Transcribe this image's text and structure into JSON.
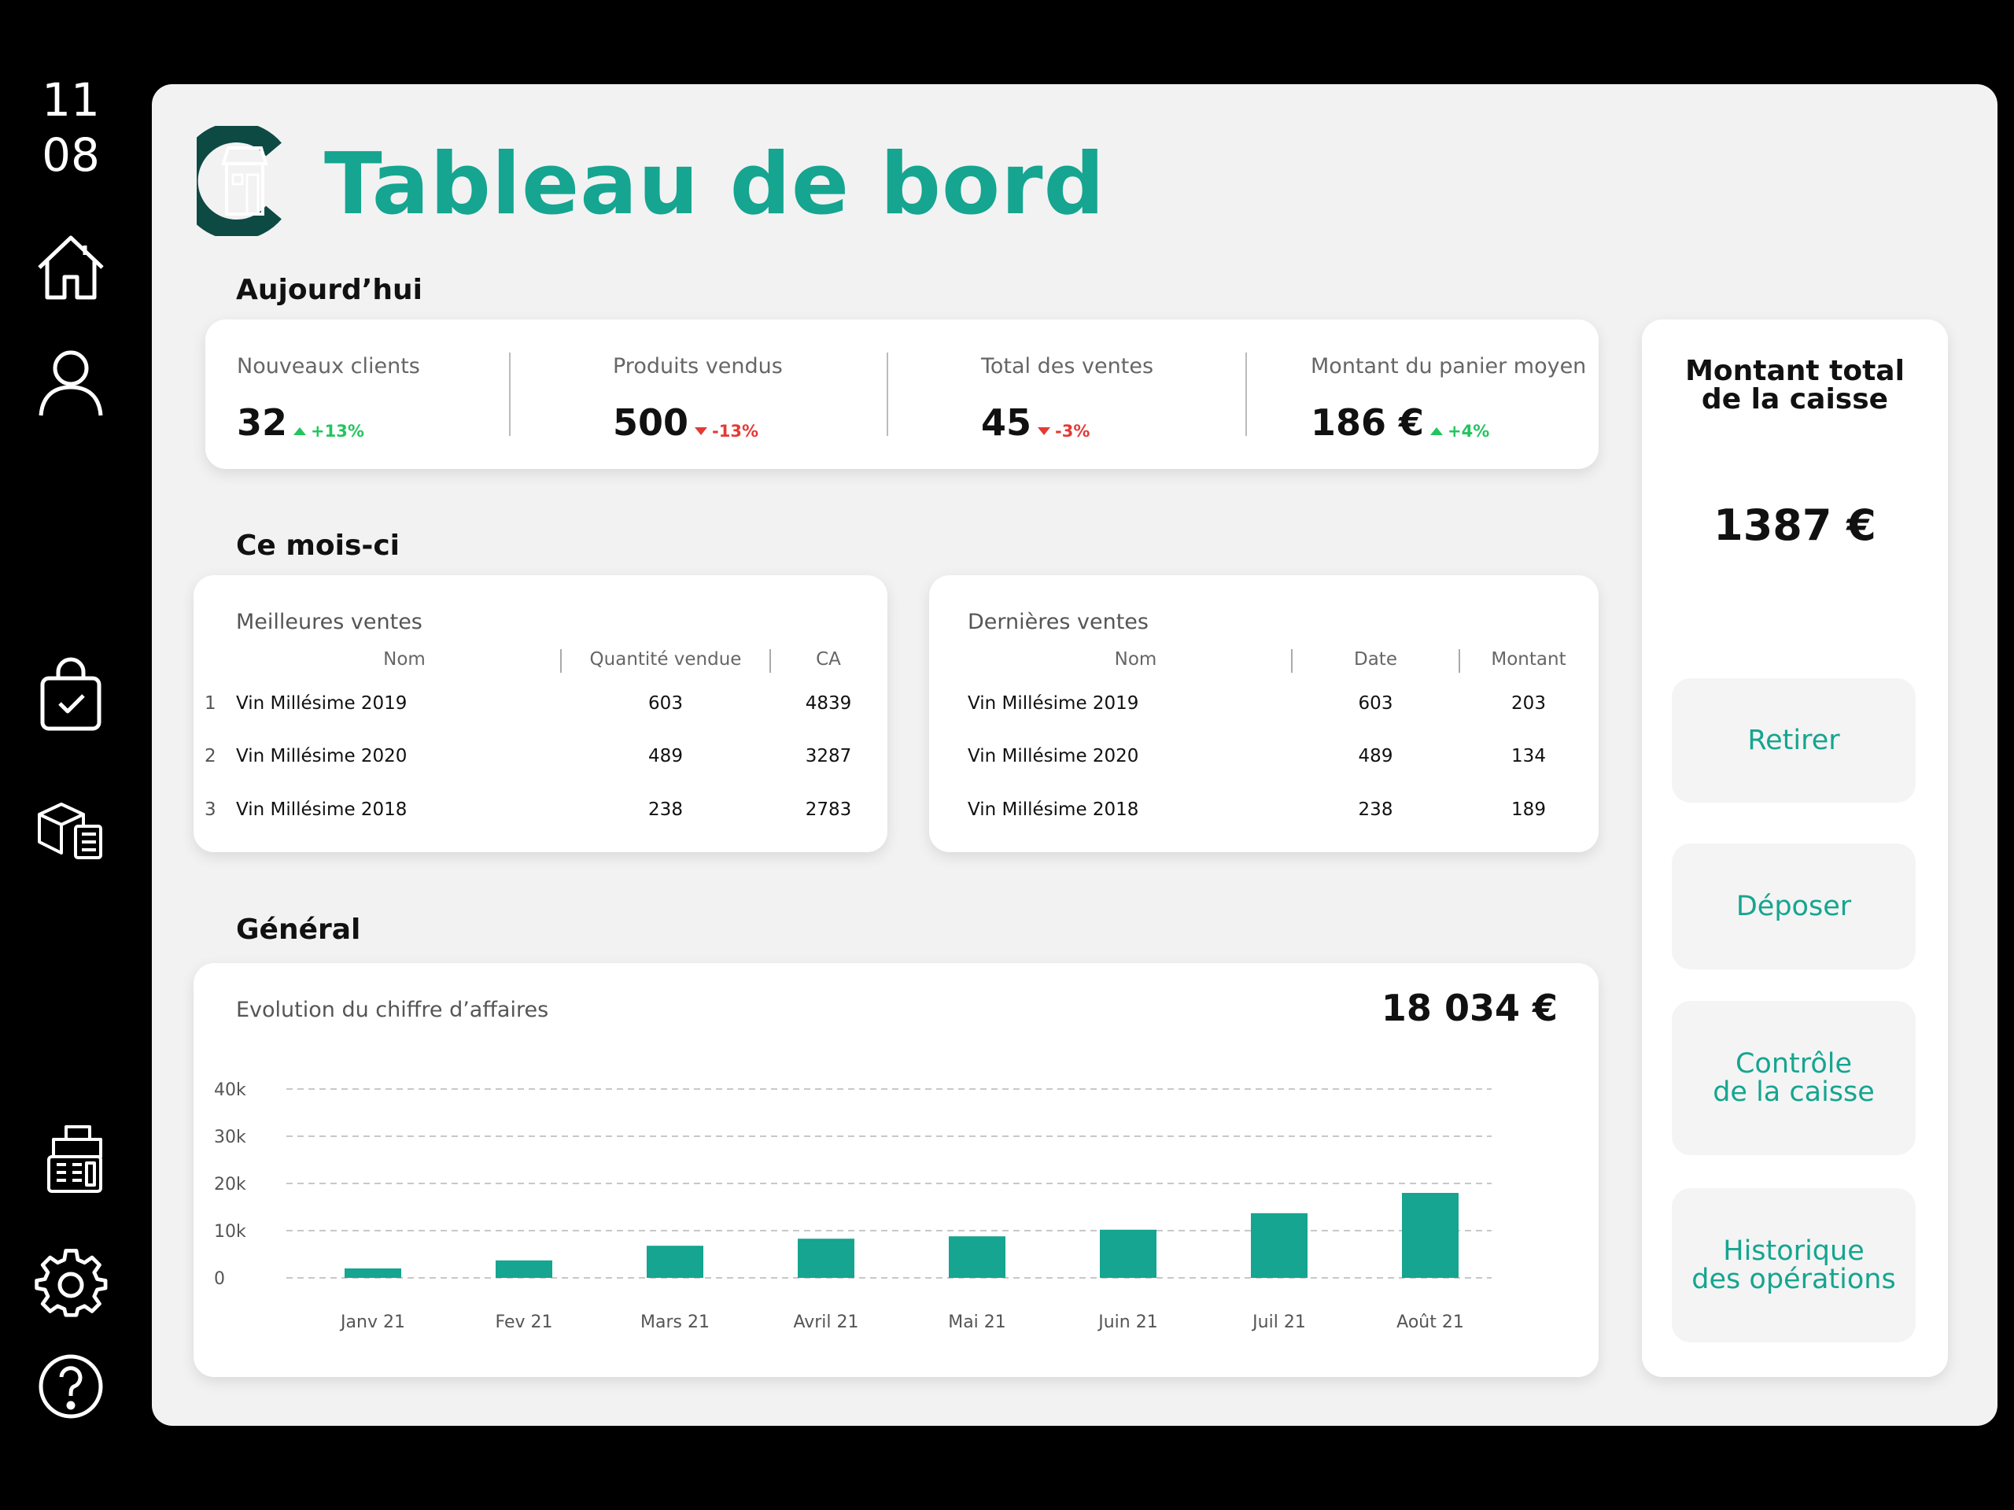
{
  "clock": {
    "hour": "11",
    "minute": "08"
  },
  "sidebar": {
    "icons": [
      "home-icon",
      "user-icon",
      "shopping-bag-icon",
      "inventory-icon",
      "cash-register-icon",
      "gear-icon",
      "help-icon"
    ]
  },
  "header": {
    "title": "Tableau de bord"
  },
  "colors": {
    "accent": "#15a590",
    "positive": "#22c55e",
    "negative": "#e53935"
  },
  "today": {
    "title": "Aujourd’hui",
    "kpis": [
      {
        "label": "Nouveaux clients",
        "value": "32",
        "delta": "+13%",
        "trend": "up"
      },
      {
        "label": "Produits vendus",
        "value": "500",
        "delta": "-13%",
        "trend": "down"
      },
      {
        "label": "Total des ventes",
        "value": "45",
        "delta": "-3%",
        "trend": "down"
      },
      {
        "label": "Montant du panier moyen",
        "value": "186 €",
        "delta": "+4%",
        "trend": "up"
      }
    ]
  },
  "month": {
    "title": "Ce mois-ci",
    "best_sales": {
      "title": "Meilleures ventes",
      "columns": [
        "Nom",
        "Quantité vendue",
        "CA"
      ],
      "rows": [
        {
          "rank": "1",
          "name": "Vin Millésime 2019",
          "qty": "603",
          "ca": "4839"
        },
        {
          "rank": "2",
          "name": "Vin Millésime 2020",
          "qty": "489",
          "ca": "3287"
        },
        {
          "rank": "3",
          "name": "Vin Millésime 2018",
          "qty": "238",
          "ca": "2783"
        }
      ]
    },
    "last_sales": {
      "title": "Dernières ventes",
      "columns": [
        "Nom",
        "Date",
        "Montant"
      ],
      "rows": [
        {
          "name": "Vin Millésime 2019",
          "date": "603",
          "amount": "203"
        },
        {
          "name": "Vin Millésime 2020",
          "date": "489",
          "amount": "134"
        },
        {
          "name": "Vin Millésime 2018",
          "date": "238",
          "amount": "189"
        }
      ]
    }
  },
  "general": {
    "title": "Général",
    "chart_title": "Evolution du chiffre d’affaires",
    "total": "18 034 €"
  },
  "cash": {
    "title_line1": "Montant total",
    "title_line2": "de la caisse",
    "amount": "1387 €",
    "buttons": {
      "withdraw": "Retirer",
      "deposit": "Déposer",
      "control_line1": "Contrôle",
      "control_line2": "de la caisse",
      "history_line1": "Historique",
      "history_line2": "des opérations"
    }
  },
  "chart_data": {
    "type": "bar",
    "title": "Evolution du chiffre d’affaires",
    "categories": [
      "Janv 21",
      "Fev 21",
      "Mars 21",
      "Avril 21",
      "Mai 21",
      "Juin 21",
      "Juil 21",
      "Août 21"
    ],
    "values": [
      2000,
      3700,
      6800,
      8300,
      8800,
      10200,
      13700,
      18000
    ],
    "yticks": [
      "0",
      "10k",
      "20k",
      "30k",
      "40k"
    ],
    "ytick_values": [
      0,
      10000,
      20000,
      30000,
      40000
    ],
    "ylim": [
      0,
      40000
    ],
    "grid": true,
    "color": "#15a590"
  }
}
